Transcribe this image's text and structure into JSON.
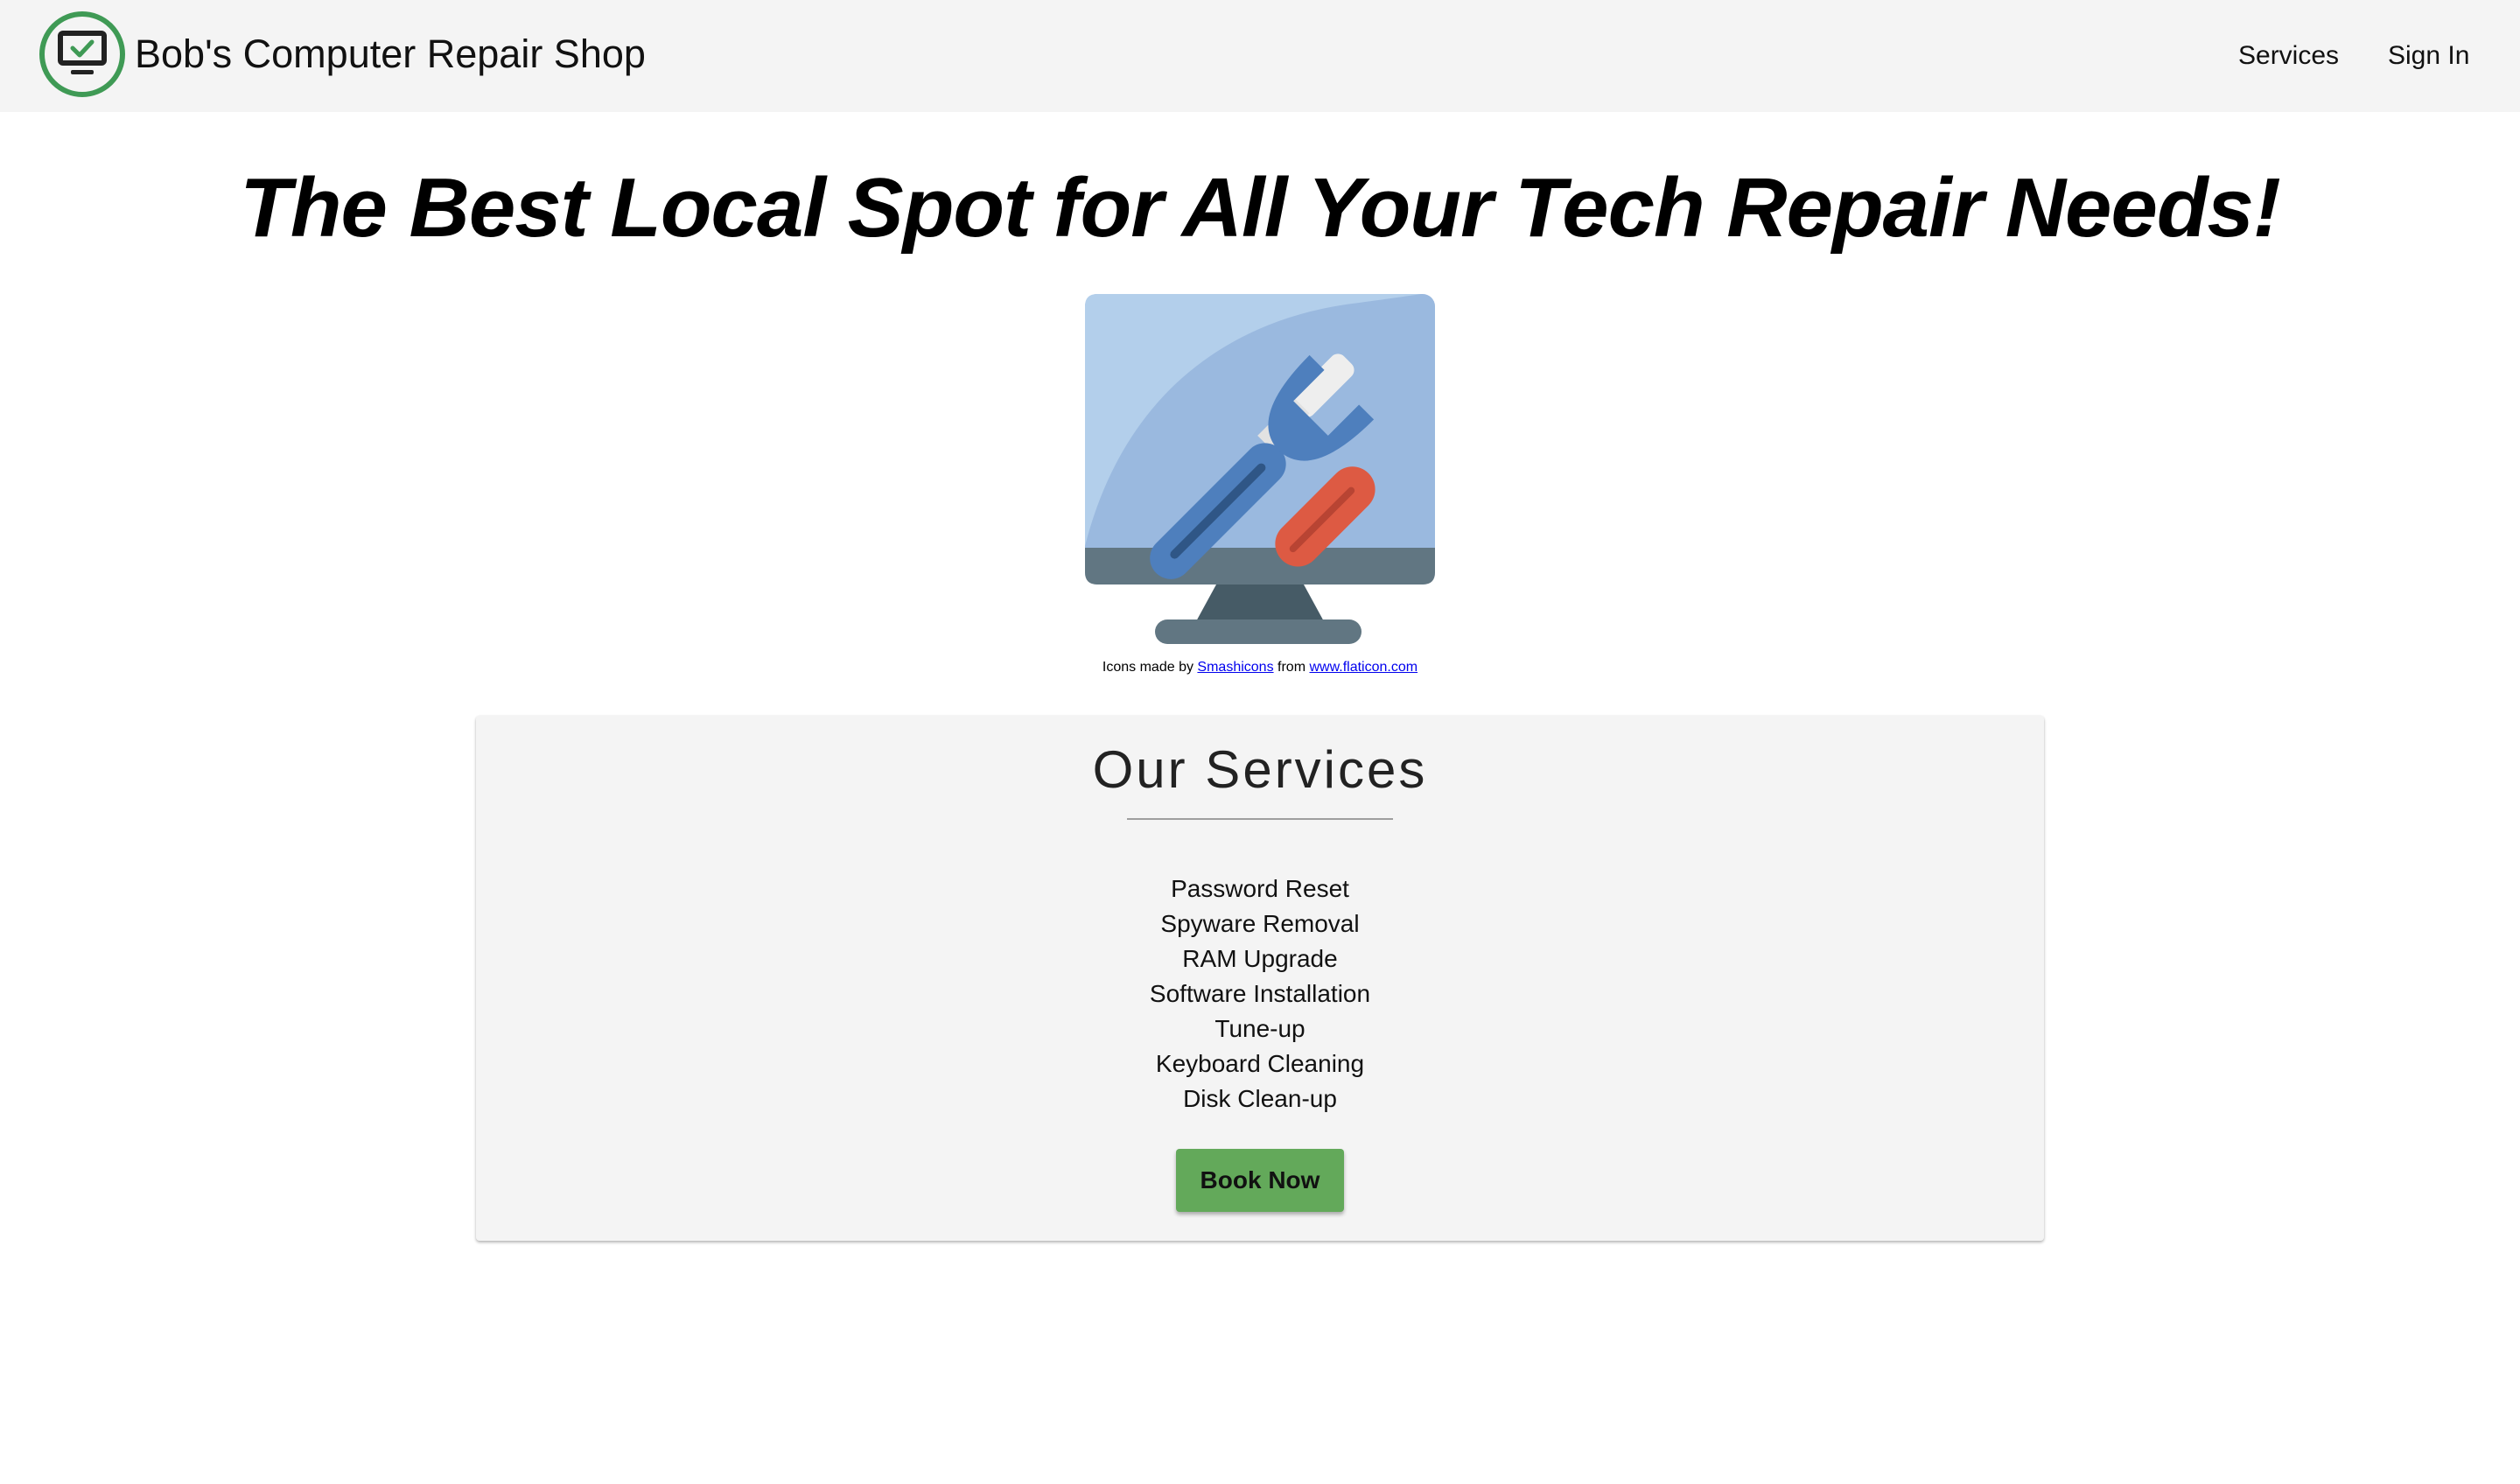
{
  "header": {
    "logo_icon": "monitor-check-icon",
    "title": "Bob's Computer Repair Shop",
    "nav": [
      {
        "label": "Services"
      },
      {
        "label": "Sign In"
      }
    ]
  },
  "hero": {
    "heading": "The Best Local Spot for All Your Tech Repair Needs!",
    "image_icon": "monitor-tools-icon",
    "credit": {
      "prefix": "Icons made by",
      "author": "Smashicons",
      "middle": "from",
      "site": "www.flaticon.com"
    }
  },
  "services": {
    "heading": "Our Services",
    "items": [
      "Password Reset",
      "Spyware Removal",
      "RAM Upgrade",
      "Software Installation",
      "Tune-up",
      "Keyboard Cleaning",
      "Disk Clean-up"
    ],
    "button_label": "Book Now"
  },
  "colors": {
    "header_bg": "#f4f4f4",
    "logo_ring": "#3f9a55",
    "button_bg": "#63a95a",
    "link": "#0000ee"
  }
}
